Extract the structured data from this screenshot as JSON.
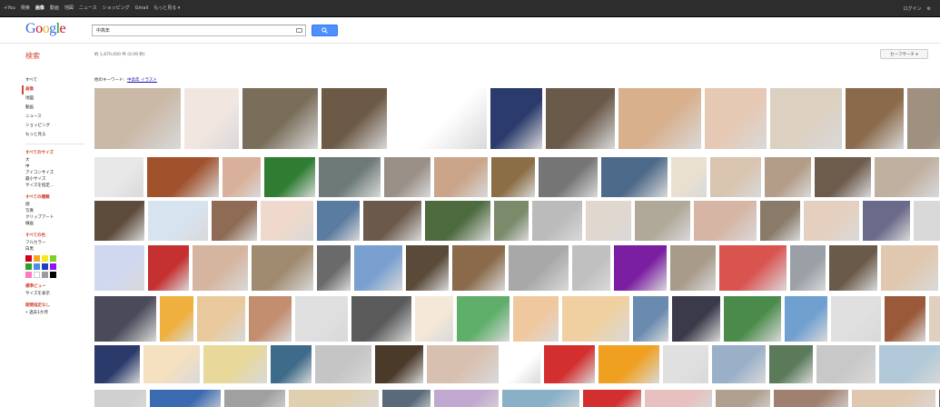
{
  "topbar": {
    "links": [
      {
        "label": "+You",
        "active": false
      },
      {
        "label": "検索",
        "active": false
      },
      {
        "label": "画像",
        "active": true
      },
      {
        "label": "動画",
        "active": false
      },
      {
        "label": "地図",
        "active": false
      },
      {
        "label": "ニュース",
        "active": false
      },
      {
        "label": "ショッピング",
        "active": false
      },
      {
        "label": "Gmail",
        "active": false
      },
      {
        "label": "もっと見る ▾",
        "active": false
      }
    ],
    "login": "ログイン"
  },
  "search": {
    "logo": [
      "G",
      "o",
      "o",
      "g",
      "l",
      "e"
    ],
    "query": "中高年"
  },
  "kensaku": "検索",
  "result_count": "約 1,870,000 件 (0.09 秒)",
  "safesearch": "セーフサーチ ▾",
  "related": {
    "label": "他のキーワード:",
    "links": [
      "中高年 イラスト"
    ]
  },
  "sidebar": {
    "items": [
      {
        "label": "すべて",
        "selected": false
      },
      {
        "label": "画像",
        "selected": true
      },
      {
        "label": "地図",
        "selected": false
      },
      {
        "label": "動画",
        "selected": false
      },
      {
        "label": "ニュース",
        "selected": false
      },
      {
        "label": "ショッピング",
        "selected": false
      },
      {
        "label": "もっと見る",
        "selected": false
      }
    ],
    "size_title": "すべてのサイズ",
    "size_options": [
      "大",
      "中",
      "アイコンサイズ",
      "最小サイズ",
      "サイズを指定..."
    ],
    "type_title": "すべての種類",
    "type_options": [
      "顔",
      "写真",
      "クリップアート",
      "線画"
    ],
    "color_title": "すべての色",
    "color_options": [
      "フルカラー",
      "白黒"
    ],
    "swatches": [
      "#d0021b",
      "#f5a623",
      "#f8e71c",
      "#7ed321",
      "#2ca02c",
      "#4a90e2",
      "#1f3fbf",
      "#9013fe",
      "#ff7ac1",
      "#ffffff",
      "#9b9b9b",
      "#000000"
    ],
    "view_title": "標準ビュー",
    "view_options": [
      "サイズを表示"
    ],
    "history_title": "期間指定なし",
    "history_options": [
      "• 過去1か月"
    ]
  },
  "thumb_colors": [
    [
      "#c9b9a6",
      "#f2e6e1",
      "#7a6e5a",
      "#6d5a46",
      "#ffffff",
      "#2b3b6c",
      "#6a5a4a",
      "#d8b08c",
      "#e5c9b5",
      "#dcd0c0",
      "#8a6a4a",
      "#a09080"
    ],
    [
      "#e8e8e8",
      "#a0522d",
      "#d9b19a",
      "#2e7d32",
      "#6d7a78",
      "#9a8f86",
      "#caa58a",
      "#8b6e46",
      "#757575",
      "#4e6a8a",
      "#e9e0d0",
      "#d9c4b0",
      "#b49d88",
      "#6d5b4c",
      "#c0b0a0",
      "#8c7b6a"
    ],
    [
      "#5d4b3b",
      "#d7e4f0",
      "#8f6b55",
      "#eed9cc",
      "#5a7ca0",
      "#6b5a4b",
      "#4d6b3f",
      "#7a8a6a",
      "#bbbbbb",
      "#e0d7cf",
      "#b0a898",
      "#d6b5a4",
      "#8a7a6a",
      "#e5d0c0",
      "#6a6a8a",
      "#d9d9d9"
    ],
    [
      "#d0d8f0",
      "#c53030",
      "#d5b5a0",
      "#a08b70",
      "#6a6a6a",
      "#7aa0d0",
      "#5a4a3a",
      "#8a6a4a",
      "#a8a8a8",
      "#c0c0c0",
      "#7b1fa2",
      "#a89b8a",
      "#d9534f",
      "#9aa0a6",
      "#6a5a4a",
      "#e0c8b0",
      "#d0a8a0"
    ],
    [
      "#4a4a5a",
      "#f0b040",
      "#e9c99b",
      "#c28e6f",
      "#e0e0e0",
      "#5a5a5a",
      "#f4e8d8",
      "#5fae6a",
      "#f0c8a0",
      "#f0d0a0",
      "#6a8ab0",
      "#3a3a4a",
      "#4a8a4a",
      "#70a0d0",
      "#e0e0e0",
      "#9a5a3a",
      "#e0d0c0"
    ],
    [
      "#2a3a6a",
      "#f5e0c0",
      "#e8d89a",
      "#3e6b8a",
      "#c5c5c5",
      "#4a3a2a",
      "#d8c0b0",
      "#ffffff",
      "#d32f2f",
      "#f0a020",
      "#e0e0e0",
      "#9ab0c8",
      "#5a7a5a",
      "#c8c8c8",
      "#b0c8d8",
      "#6a5a4a"
    ],
    [
      "#d0d0d0",
      "#3a6ab0",
      "#a0a0a0",
      "#e0d0b0",
      "#5a6a7a",
      "#c0a8d0",
      "#8ab0c8",
      "#d32f2f",
      "#e8c0c0",
      "#b0a090",
      "#a08070",
      "#e0c8b0",
      "#6a5a4a"
    ]
  ]
}
